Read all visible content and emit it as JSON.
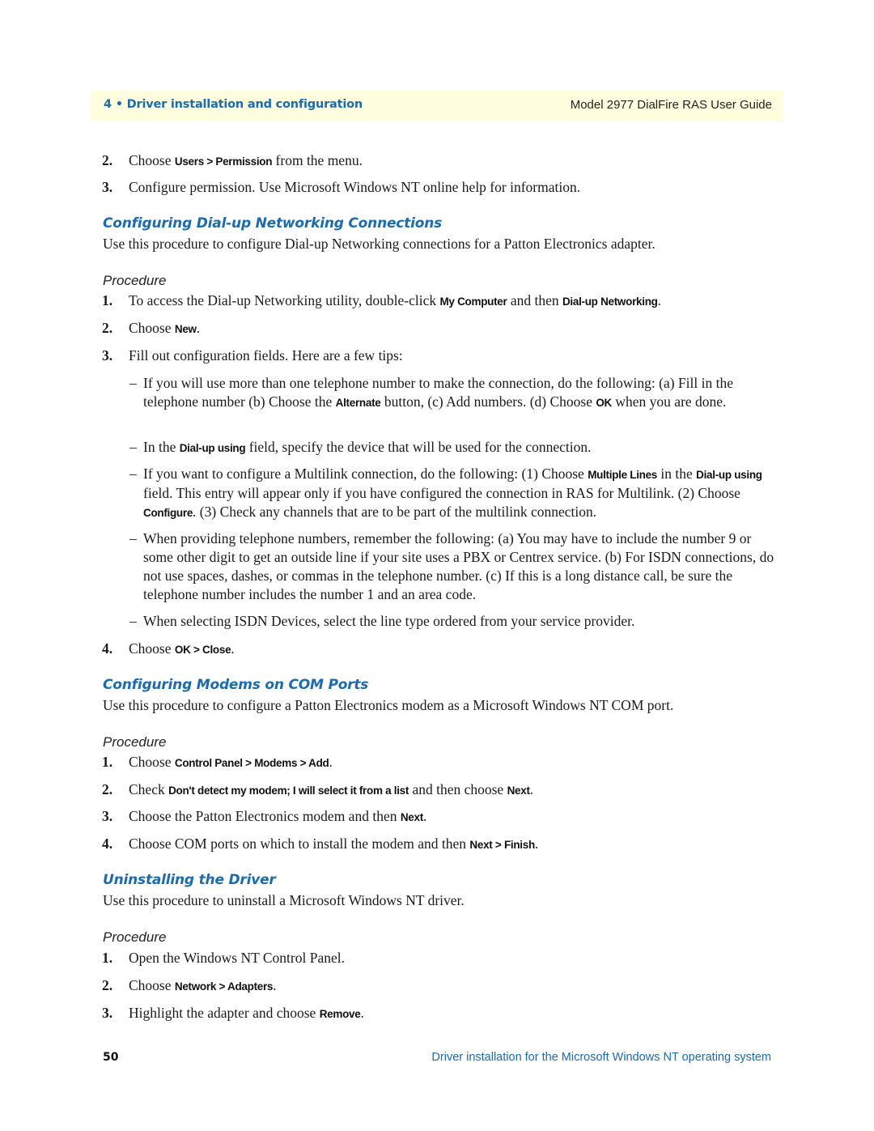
{
  "header": {
    "chapter": "4 • Driver installation and configuration",
    "guide_title": "Model 2977 DialFire RAS User Guide"
  },
  "top_steps": [
    {
      "num": "2.",
      "pre": "Choose ",
      "cmd": "Users > Permission",
      "post": " from the menu."
    },
    {
      "num": "3.",
      "text": "Configure permission. Use Microsoft Windows NT online help for information."
    }
  ],
  "sections": {
    "dialup": {
      "title": "Configuring Dial-up Networking Connections",
      "intro": "Use this procedure to configure Dial-up Networking connections for a Patton Electronics adapter.",
      "procedure_label": "Procedure",
      "steps": {
        "s1": {
          "num": "1.",
          "pre": "To access the Dial-up Networking utility, double-click ",
          "cmd1": "My Computer",
          "mid": " and then ",
          "cmd2": "Dial-up Networking",
          "post": "."
        },
        "s2": {
          "num": "2.",
          "pre": "Choose ",
          "cmd": "New",
          "post": "."
        },
        "s3": {
          "num": "3.",
          "text": "Fill out configuration fields. Here are a few tips:"
        },
        "s4": {
          "num": "4.",
          "pre": "Choose ",
          "cmd": "OK > Close",
          "post": "."
        }
      },
      "tips": {
        "t1": {
          "a": "If you will use more than one telephone number to make the connection, do the following: (a) Fill in the telephone number (b) Choose the ",
          "cmd1": "Alternate",
          "b": " button, (c) Add numbers. (d) Choose ",
          "cmd2": "OK",
          "c": " when you are done."
        },
        "t2": {
          "a": "In the ",
          "cmd1": "Dial-up using",
          "b": " field, specify the device that will be used for the connection."
        },
        "t3": {
          "a": "If you want to configure a Multilink connection, do the following: (1) Choose ",
          "cmd1": "Multiple Lines",
          "b": " in the ",
          "cmd2": "Dial-up using",
          "c": " field. This entry will appear only if you have configured the connection in RAS for Multilink. (2) Choose ",
          "cmd3": "Configure",
          "d": ". (3) Check any channels that are to be part of the multilink connection."
        },
        "t4": {
          "a": "When providing telephone numbers, remember the following: (a) You may have to include the number 9 or some other digit to get an outside line if your site uses a PBX or Centrex service. (b) For ISDN connections, do not use spaces, dashes, or commas in the telephone number. (c) If this is a long distance call, be sure the telephone number includes the number 1 and an area code."
        },
        "t5": {
          "a": "When selecting ISDN Devices, select the line type ordered from your service provider."
        }
      }
    },
    "modems": {
      "title": "Configuring Modems on COM Ports",
      "intro": "Use this procedure to configure a Patton Electronics modem as a Microsoft Windows NT COM port.",
      "procedure_label": "Procedure",
      "steps": {
        "s1": {
          "num": "1.",
          "pre": "Choose ",
          "cmd": "Control Panel > Modems > Add",
          "post": "."
        },
        "s2": {
          "num": "2.",
          "pre": "Check ",
          "cmd1": "Don't detect my modem; I will select it from a list",
          "mid": " and then choose ",
          "cmd2": "Next",
          "post": "."
        },
        "s3": {
          "num": "3.",
          "pre": "Choose the Patton Electronics modem and then ",
          "cmd": "Next",
          "post": "."
        },
        "s4": {
          "num": "4.",
          "pre": "Choose COM ports on which to install the modem and then ",
          "cmd": "Next > Finish",
          "post": "."
        }
      }
    },
    "uninstall": {
      "title": "Uninstalling the Driver",
      "intro": "Use this procedure to uninstall a Microsoft Windows NT driver.",
      "procedure_label": "Procedure",
      "steps": {
        "s1": {
          "num": "1.",
          "text": "Open the Windows NT Control Panel."
        },
        "s2": {
          "num": "2.",
          "pre": "Choose ",
          "cmd": "Network > Adapters",
          "post": "."
        },
        "s3": {
          "num": "3.",
          "pre": "Highlight the adapter and choose ",
          "cmd": "Remove",
          "post": "."
        }
      }
    }
  },
  "footer": {
    "page_number": "50",
    "section_title": "Driver installation for the Microsoft Windows NT operating system"
  },
  "colors": {
    "accent_blue": "#1a6bb0",
    "header_background": "#ffffe0"
  }
}
